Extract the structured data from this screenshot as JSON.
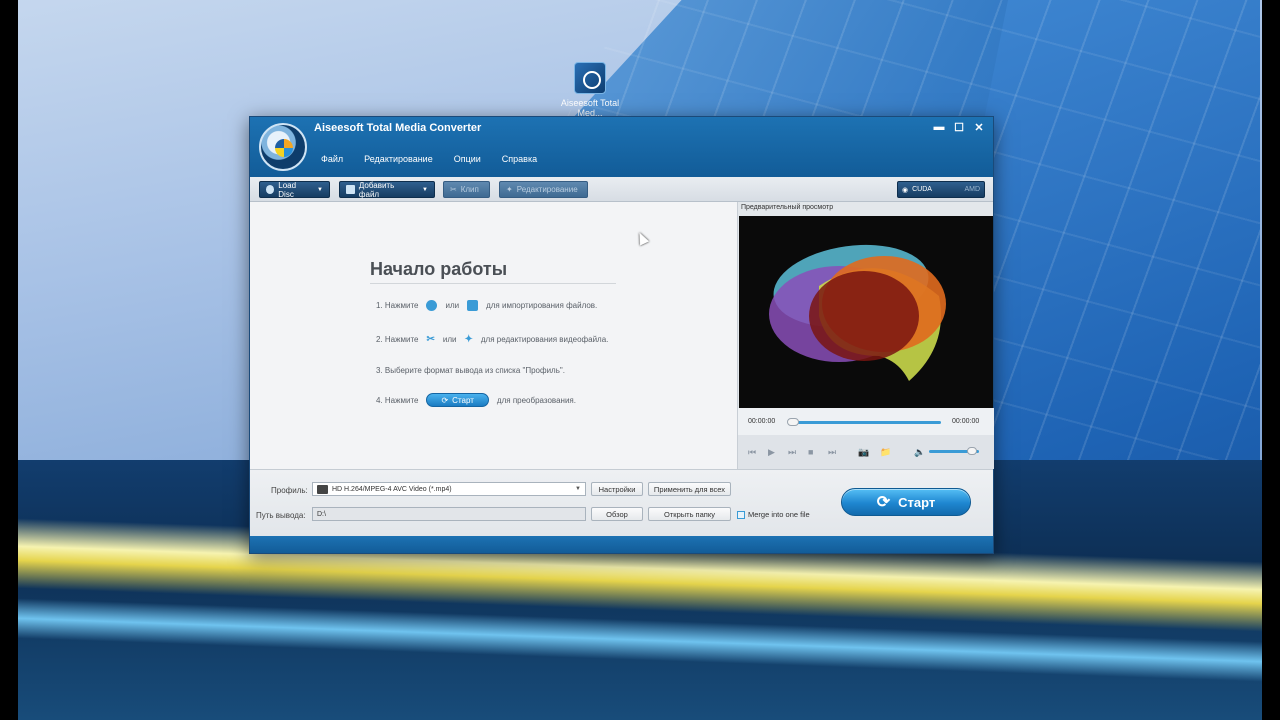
{
  "desktop": {
    "icon_label": "Aiseesoft Total Med..."
  },
  "window": {
    "title": "Aiseesoft Total Media Converter",
    "controls": {
      "minimize": "▬",
      "maximize": "☐",
      "close": "✕"
    }
  },
  "menu": {
    "items": [
      "Файл",
      "Редактирование",
      "Опции",
      "Справка"
    ]
  },
  "toolbar": {
    "load_disc": "Load Disc",
    "add_file": "Добавить файл",
    "clip": "Клип",
    "edit": "Редактирование",
    "cuda": "CUDA",
    "amd": "AMD"
  },
  "start": {
    "title": "Начало работы",
    "step1_prefix": "1. Нажмите",
    "step1_or": "или",
    "step1_suffix": "для импортирования файлов.",
    "step2_prefix": "2. Нажмите",
    "step2_or": "или",
    "step2_suffix": "для редактирования видеофайла.",
    "step3": "3. Выберите формат вывода из списка \"Профиль\".",
    "step4_prefix": "4. Нажмите",
    "step4_button": "Старт",
    "step4_suffix": "для преобразования."
  },
  "preview": {
    "label": "Предварительный просмотр",
    "time_current": "00:00:00",
    "time_total": "00:00:00",
    "progress": 0,
    "volume": 0.8
  },
  "bottom": {
    "profile_label": "Профиль:",
    "profile_value": "HD H.264/MPEG-4 AVC Video (*.mp4)",
    "settings": "Настройки",
    "apply_all": "Применить для всех",
    "path_label": "Путь вывода:",
    "path_value": "D:\\",
    "browse": "Обзор",
    "open_folder": "Открыть папку",
    "merge": "Merge into one file",
    "start": "Старт"
  },
  "colors": {
    "accent": "#1d72b3",
    "start_button": "#1e86d0"
  }
}
